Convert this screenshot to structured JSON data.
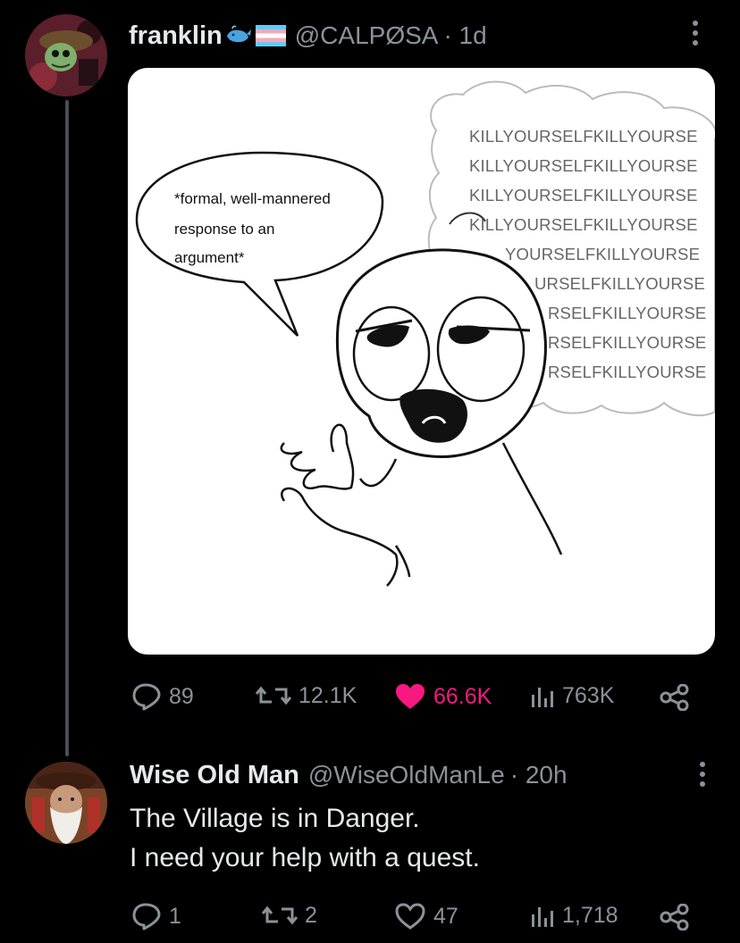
{
  "post": {
    "display_name": "franklin",
    "name_emojis": [
      "whale-icon",
      "trans-flag-icon"
    ],
    "handle": "@CALPØSA",
    "time": "· 1d",
    "comic": {
      "speech_bubble": [
        "*formal, well-mannered",
        "response to an",
        "argument*"
      ],
      "thought_lines": [
        "KILLYOURSELFKILLYOURSE",
        "KILLYOURSELFKILLYOURSE",
        "KILLYOURSELFKILLYOURSE",
        "KILLYOURSELFKILLYOURSE",
        "YOURSELFKILLYOURSE",
        "URSELFKILLYOURSE",
        "RSELFKILLYOURSE",
        "RSELFKILLYOURSE",
        "RSELFKILLYOURSE"
      ]
    },
    "stats": {
      "replies": "89",
      "reposts": "12.1K",
      "likes": "66.6K",
      "views": "763K"
    },
    "colors": {
      "like": "#f91880",
      "muted": "#8b9298"
    }
  },
  "reply": {
    "display_name": "Wise Old Man",
    "handle": "@WiseOldManLe",
    "time": "· 20h",
    "text_line1": "The Village is in Danger.",
    "text_line2": "I need your help with a quest.",
    "stats": {
      "replies": "1",
      "reposts": "2",
      "likes": "47",
      "views": "1,718"
    }
  }
}
